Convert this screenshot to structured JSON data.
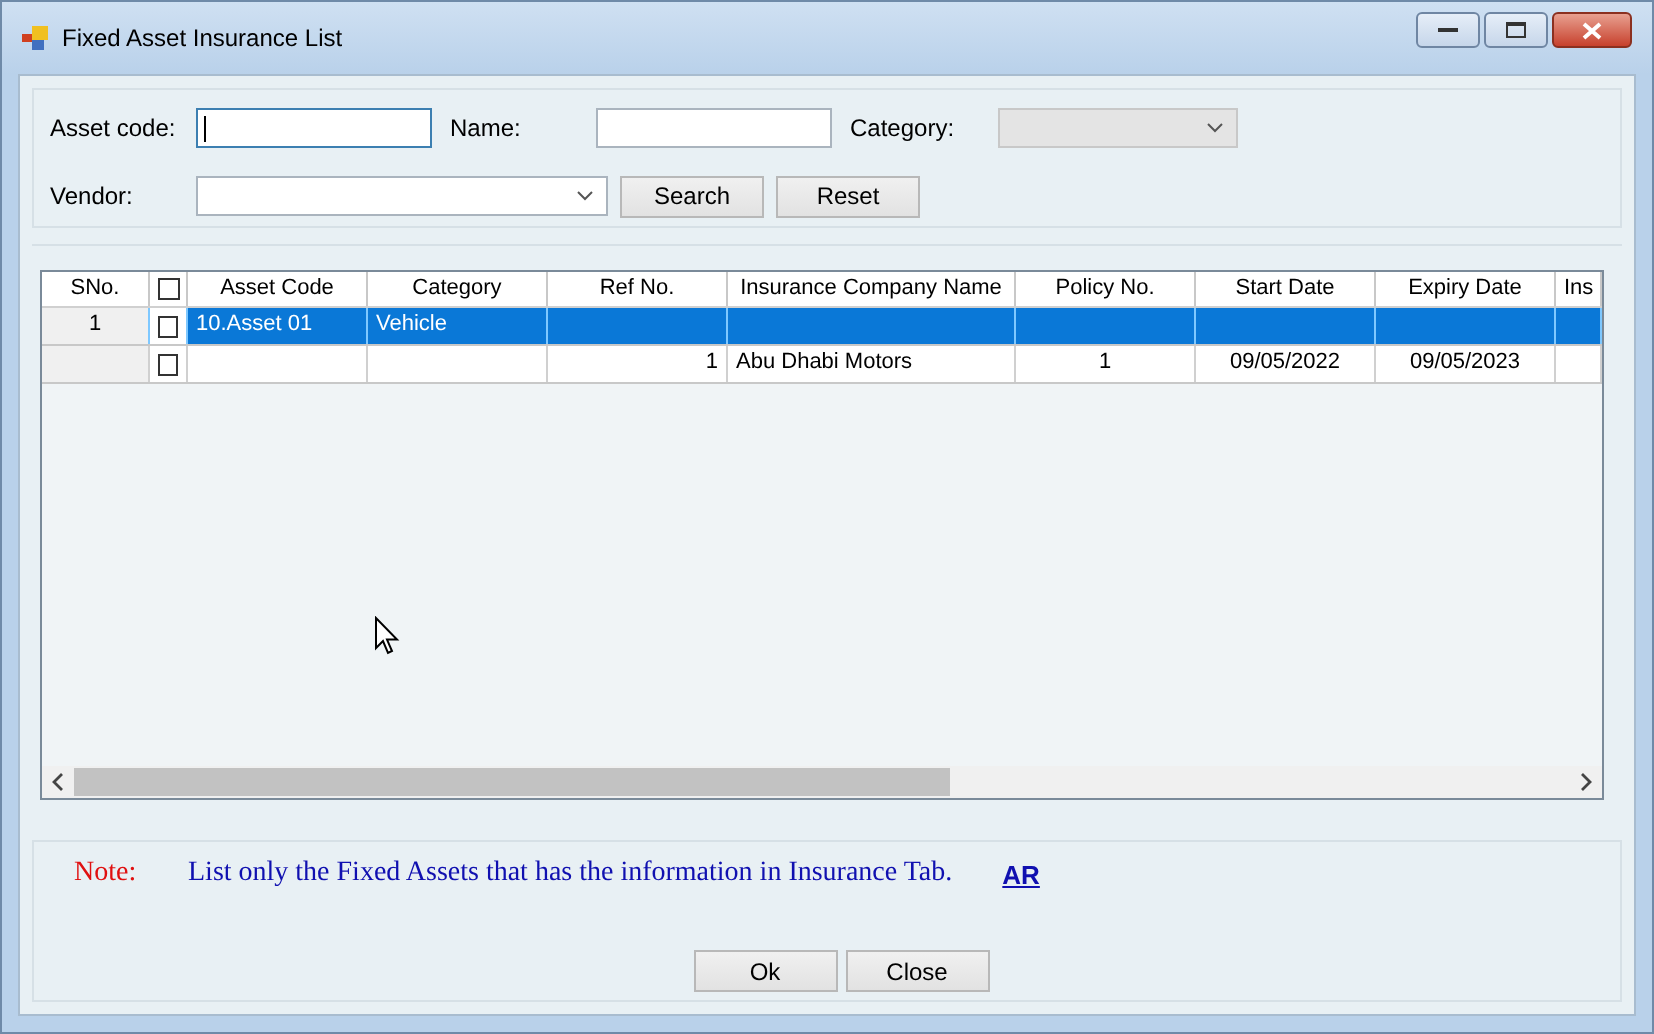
{
  "window": {
    "title": "Fixed Asset Insurance List"
  },
  "filters": {
    "asset_code": {
      "label": "Asset code:"
    },
    "name": {
      "label": "Name:"
    },
    "category": {
      "label": "Category:",
      "disabled": true
    },
    "vendor": {
      "label": "Vendor:"
    },
    "buttons": [
      "Search",
      "Reset"
    ]
  },
  "table": {
    "header_checked": false,
    "columns": [
      "SNo.",
      "Asset Code",
      "Category",
      "Ref No.",
      "Insurance Company Name",
      "Policy No.",
      "Start Date",
      "Expiry Date",
      "Ins"
    ],
    "rows": [
      {
        "selected": true,
        "checked": false,
        "cells": [
          "1",
          "10.Asset 01",
          "Vehicle",
          null,
          null,
          null,
          null,
          null,
          null
        ]
      },
      {
        "selected": false,
        "checked": false,
        "cells": [
          null,
          null,
          null,
          "1",
          "Abu Dhabi Motors",
          "1",
          "09/05/2022",
          "09/05/2023",
          null
        ]
      }
    ]
  },
  "note": {
    "label": "Note:",
    "text": "List only the Fixed Assets that has the information in Insurance Tab.",
    "link": "AR"
  },
  "buttons": [
    "Ok",
    "Close"
  ]
}
